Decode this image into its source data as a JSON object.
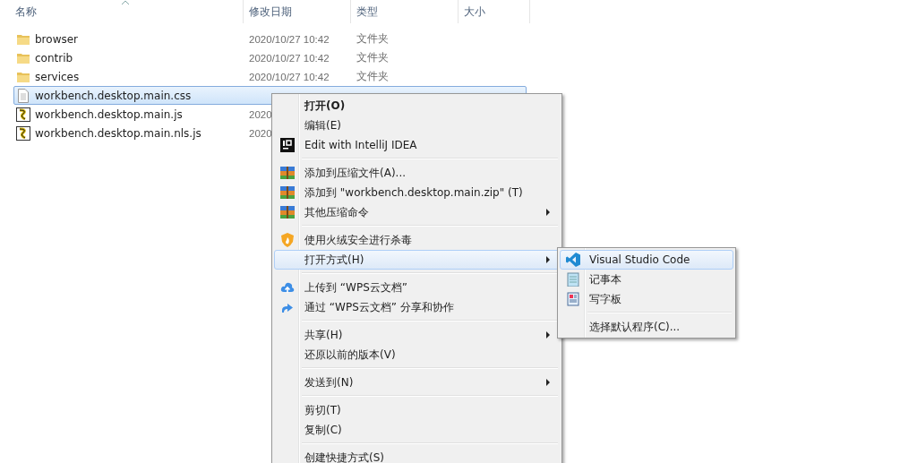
{
  "columns": [
    {
      "label": "名称",
      "sorted": true
    },
    {
      "label": "修改日期"
    },
    {
      "label": "类型"
    },
    {
      "label": "大小"
    }
  ],
  "files": [
    {
      "name": "browser",
      "kind": "folder",
      "date": "2020/10/27 10:42",
      "type": "文件夹",
      "selected": false
    },
    {
      "name": "contrib",
      "kind": "folder",
      "date": "2020/10/27 10:42",
      "type": "文件夹",
      "selected": false
    },
    {
      "name": "services",
      "kind": "folder",
      "date": "2020/10/27 10:42",
      "type": "文件夹",
      "selected": false
    },
    {
      "name": "workbench.desktop.main.css",
      "kind": "text",
      "selected": true
    },
    {
      "name": "workbench.desktop.main.js",
      "kind": "script",
      "date": "2020",
      "selected": false
    },
    {
      "name": "workbench.desktop.main.nls.js",
      "kind": "script",
      "date": "2020",
      "selected": false
    }
  ],
  "context_menu": {
    "items": [
      {
        "kind": "item",
        "label": "打开(O)",
        "bold": true,
        "selected": false
      },
      {
        "kind": "item",
        "label": "编辑(E)",
        "selected": false
      },
      {
        "kind": "item",
        "label": "Edit with IntelliJ IDEA",
        "selected": false
      },
      {
        "kind": "separator"
      },
      {
        "kind": "item",
        "label": "添加到压缩文件(A)...",
        "selected": false
      },
      {
        "kind": "item",
        "label": "添加到 \"workbench.desktop.main.zip\" (T)",
        "selected": false
      },
      {
        "kind": "item",
        "label": "其他压缩命令",
        "has_submenu": true,
        "selected": false
      },
      {
        "kind": "separator"
      },
      {
        "kind": "item",
        "label": "使用火绒安全进行杀毒",
        "selected": false
      },
      {
        "kind": "item",
        "label": "打开方式(H)",
        "has_submenu": true,
        "selected": true
      },
      {
        "kind": "separator"
      },
      {
        "kind": "item",
        "label": "上传到 “WPS云文档”",
        "selected": false
      },
      {
        "kind": "item",
        "label": "通过 “WPS云文档” 分享和协作",
        "selected": false
      },
      {
        "kind": "separator"
      },
      {
        "kind": "item",
        "label": "共享(H)",
        "has_submenu": true,
        "selected": false
      },
      {
        "kind": "item",
        "label": "还原以前的版本(V)",
        "selected": false
      },
      {
        "kind": "separator"
      },
      {
        "kind": "item",
        "label": "发送到(N)",
        "has_submenu": true,
        "selected": false
      },
      {
        "kind": "separator"
      },
      {
        "kind": "item",
        "label": "剪切(T)",
        "selected": false
      },
      {
        "kind": "item",
        "label": "复制(C)",
        "selected": false
      },
      {
        "kind": "separator"
      },
      {
        "kind": "item",
        "label": "创建快捷方式(S)",
        "selected": false
      }
    ]
  },
  "submenu": {
    "items": [
      {
        "kind": "item",
        "label": "Visual Studio Code",
        "selected": true
      },
      {
        "kind": "item",
        "label": "记事本",
        "selected": false
      },
      {
        "kind": "item",
        "label": "写字板",
        "selected": false
      },
      {
        "kind": "separator"
      },
      {
        "kind": "item",
        "label": "选择默认程序(C)...",
        "selected": false
      }
    ]
  }
}
